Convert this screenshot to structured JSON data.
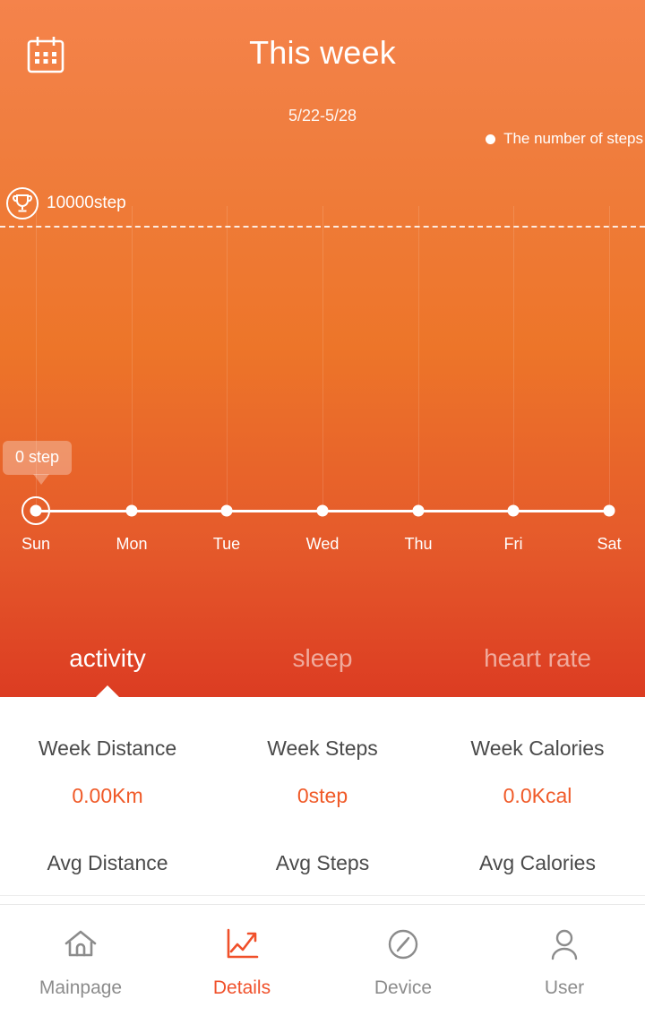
{
  "header": {
    "calendar_icon": "calendar-icon",
    "title": "This week",
    "date_range": "5/22-5/28"
  },
  "chart": {
    "legend_label": "The number of steps",
    "goal_icon": "trophy-icon",
    "goal_label": "10000step",
    "tooltip_text": "0 step",
    "selected_day": "Sun"
  },
  "chart_data": {
    "type": "line",
    "title": "This week",
    "subtitle": "5/22-5/28",
    "categories": [
      "Sun",
      "Mon",
      "Tue",
      "Wed",
      "Thu",
      "Fri",
      "Sat"
    ],
    "values": [
      0,
      0,
      0,
      0,
      0,
      0,
      0
    ],
    "series": [
      {
        "name": "The number of steps",
        "values": [
          0,
          0,
          0,
          0,
          0,
          0,
          0
        ]
      }
    ],
    "goal_value": 10000,
    "goal_label": "10000step",
    "xlabel": "",
    "ylabel": "",
    "ylim": [
      0,
      10000
    ],
    "grid": true,
    "legend_position": "top-right",
    "annotations": [
      {
        "category": "Sun",
        "value": 0,
        "text": "0 step"
      }
    ],
    "line_color": "#FFFFFF",
    "point_color": "#FFFFFF"
  },
  "tabs": [
    {
      "label": "activity",
      "active": true
    },
    {
      "label": "sleep",
      "active": false
    },
    {
      "label": "heart rate",
      "active": false
    }
  ],
  "stats": {
    "row1": [
      {
        "label": "Week Distance",
        "value": "0.00Km"
      },
      {
        "label": "Week Steps",
        "value": "0step"
      },
      {
        "label": "Week Calories",
        "value": "0.0Kcal"
      }
    ],
    "row2": [
      {
        "label": "Avg Distance",
        "value": ""
      },
      {
        "label": "Avg Steps",
        "value": ""
      },
      {
        "label": "Avg Calories",
        "value": ""
      }
    ]
  },
  "bottom_nav": [
    {
      "label": "Mainpage",
      "icon": "home-icon",
      "active": false
    },
    {
      "label": "Details",
      "icon": "chart-trend-icon",
      "active": true
    },
    {
      "label": "Device",
      "icon": "compass-icon",
      "active": false
    },
    {
      "label": "User",
      "icon": "person-icon",
      "active": false
    }
  ],
  "colors": {
    "accent": "#F05A28",
    "gradient_top": "#F5834B",
    "gradient_bottom": "#DC3C22",
    "muted_text": "#8C8C8C"
  }
}
